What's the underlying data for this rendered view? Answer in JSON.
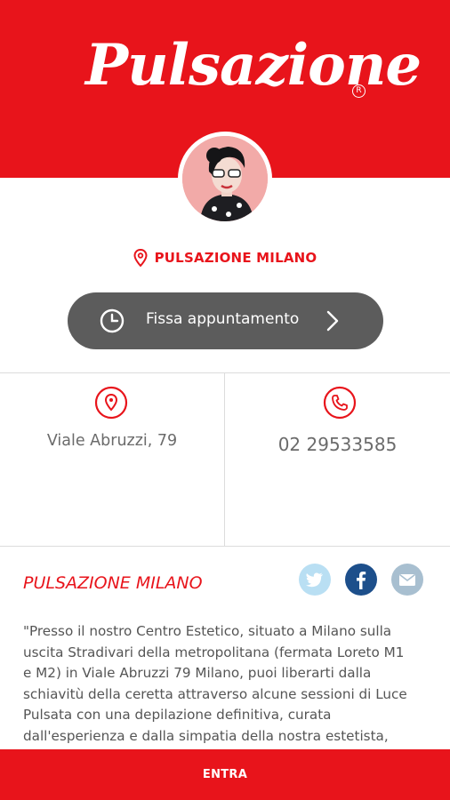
{
  "header": {
    "logo_text": "Pulsazione",
    "registered_mark": "R"
  },
  "location": {
    "name": "PULSAZIONE MILANO"
  },
  "appointment": {
    "label": "Fissa appuntamento"
  },
  "contacts": {
    "address": "Viale Abruzzi, 79",
    "phone": "02 29533585"
  },
  "section": {
    "title": "PULSAZIONE MILANO",
    "social": [
      "twitter-icon",
      "facebook-icon",
      "email-icon"
    ],
    "description": "\"Presso il nostro Centro Estetico, situato a Milano sulla\nuscita Stradivari della metropolitana (fermata Loreto M1\ne M2) in Viale Abruzzi 79 Milano, puoi liberarti dalla\nschiavitù della ceretta attraverso alcune sessioni di Luce\nPulsata con una depilazione definitiva, curata\ndall'esperienza e dalla simpatia della nostra estetista,"
  },
  "footer": {
    "enter_label": "ENTRA"
  },
  "colors": {
    "brand_red": "#e8141b",
    "button_gray": "#5c5c5c",
    "twitter": "#b9dff3",
    "facebook": "#1d4f8b",
    "email": "#a8bfd0"
  }
}
